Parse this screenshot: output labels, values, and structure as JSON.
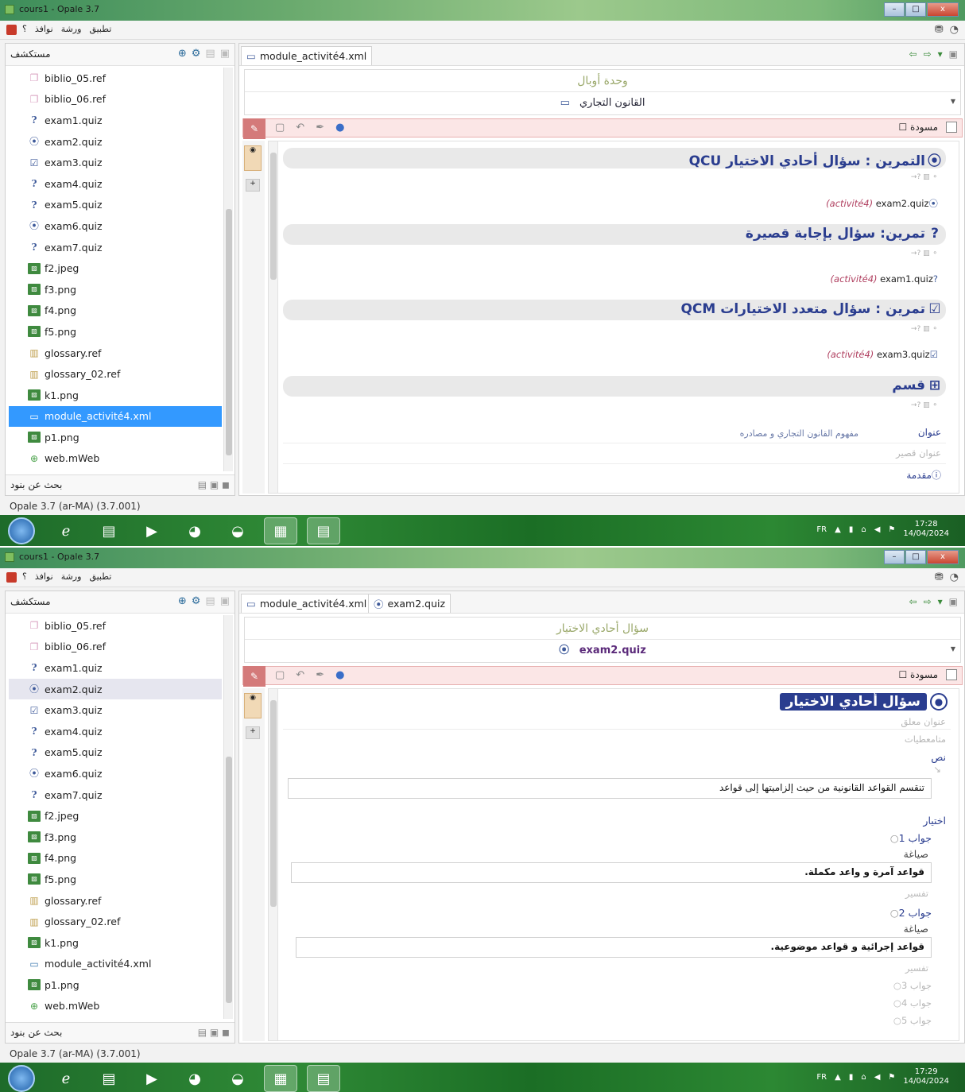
{
  "window": {
    "title": "cours1 - Opale 3.7",
    "menus": [
      "؟",
      "نوافذ",
      "ورشة",
      "تطبيق"
    ],
    "controls": [
      "–",
      "□",
      "x"
    ]
  },
  "explorer": {
    "title": "مستكشف",
    "search_label": "بحث عن بنود",
    "files": [
      {
        "name": "biblio_05.ref",
        "icon": "ref-icon"
      },
      {
        "name": "biblio_06.ref",
        "icon": "ref-icon"
      },
      {
        "name": "exam1.quiz",
        "icon": "question-icon"
      },
      {
        "name": "exam2.quiz",
        "icon": "radio-icon"
      },
      {
        "name": "exam3.quiz",
        "icon": "checkbox-icon"
      },
      {
        "name": "exam4.quiz",
        "icon": "question-icon"
      },
      {
        "name": "exam5.quiz",
        "icon": "question-icon"
      },
      {
        "name": "exam6.quiz",
        "icon": "radio-icon"
      },
      {
        "name": "exam7.quiz",
        "icon": "question-icon"
      },
      {
        "name": "f2.jpeg",
        "icon": "image-icon"
      },
      {
        "name": "f3.png",
        "icon": "image-icon"
      },
      {
        "name": "f4.png",
        "icon": "image-icon"
      },
      {
        "name": "f5.png",
        "icon": "image-icon"
      },
      {
        "name": "glossary.ref",
        "icon": "glossary-icon"
      },
      {
        "name": "glossary_02.ref",
        "icon": "glossary-icon"
      },
      {
        "name": "k1.png",
        "icon": "image-icon"
      },
      {
        "name": "module_activité4.xml",
        "icon": "module-icon"
      },
      {
        "name": "p1.png",
        "icon": "image-icon"
      },
      {
        "name": "web.mWeb",
        "icon": "web-icon"
      }
    ]
  },
  "status_text": "Opale 3.7 (ar-MA) (3.7.001)",
  "taskbar": {
    "lang": "FR",
    "date": "14/04/2024",
    "apps": [
      "ie-icon",
      "folder-icon",
      "media-icon",
      "chrome-icon",
      "firefox-icon",
      "opale-icon",
      "word-icon"
    ]
  },
  "shot1": {
    "time": "17:28",
    "tab": "module_activité4.xml",
    "breadcrumb_title": "وحدة أوبال",
    "breadcrumb_sub": "القانون التجاري",
    "draft_label": "مسودة",
    "blocks": [
      {
        "title": "التمرين : سؤال أحادي الاختيار QCU",
        "ref_act": "(activité4)",
        "ref_file": "exam2.quiz"
      },
      {
        "title": "تمرين: سؤال بإجابة قصيرة",
        "ref_act": "(activité4)",
        "ref_file": "exam1.quiz"
      },
      {
        "title": "تمرين : سؤال متعدد الاختيارات QCM",
        "ref_act": "(activité4)",
        "ref_file": "exam3.quiz"
      }
    ],
    "section": {
      "title": "قسم",
      "label_title": "عنوان",
      "title_value": "مفهوم القانون التجاري و مصادره",
      "label_short": "عنوان قصير",
      "label_intro": "مقدمة"
    }
  },
  "shot2": {
    "time": "17:29",
    "tabs": [
      "module_activité4.xml",
      "exam2.quiz"
    ],
    "breadcrumb_title": "سؤال أحادي الاختيار",
    "breadcrumb_sub": "exam2.quiz",
    "draft_label": "مسودة",
    "quiz": {
      "title": "سؤال أحادي الاختيار",
      "label_title": "عنوان معلق",
      "label_meta": "متامعطيات",
      "label_text": "نص",
      "question": "تنقسم القواعد القانونية من حيث إلزاميتها إلى قواعد",
      "label_choice": "اختيار",
      "answers": [
        {
          "label": "جواب 1",
          "format": "صياغة",
          "text": "قواعد آمرة و واعد مكملة.",
          "explain": "تفسير"
        },
        {
          "label": "جواب 2",
          "format": "صياغة",
          "text": "قواعد إجرائية و قواعد موضوعية.",
          "explain": "تفسير"
        }
      ],
      "more_answers": [
        "جواب 3",
        "جواب 4",
        "جواب 5"
      ]
    }
  }
}
